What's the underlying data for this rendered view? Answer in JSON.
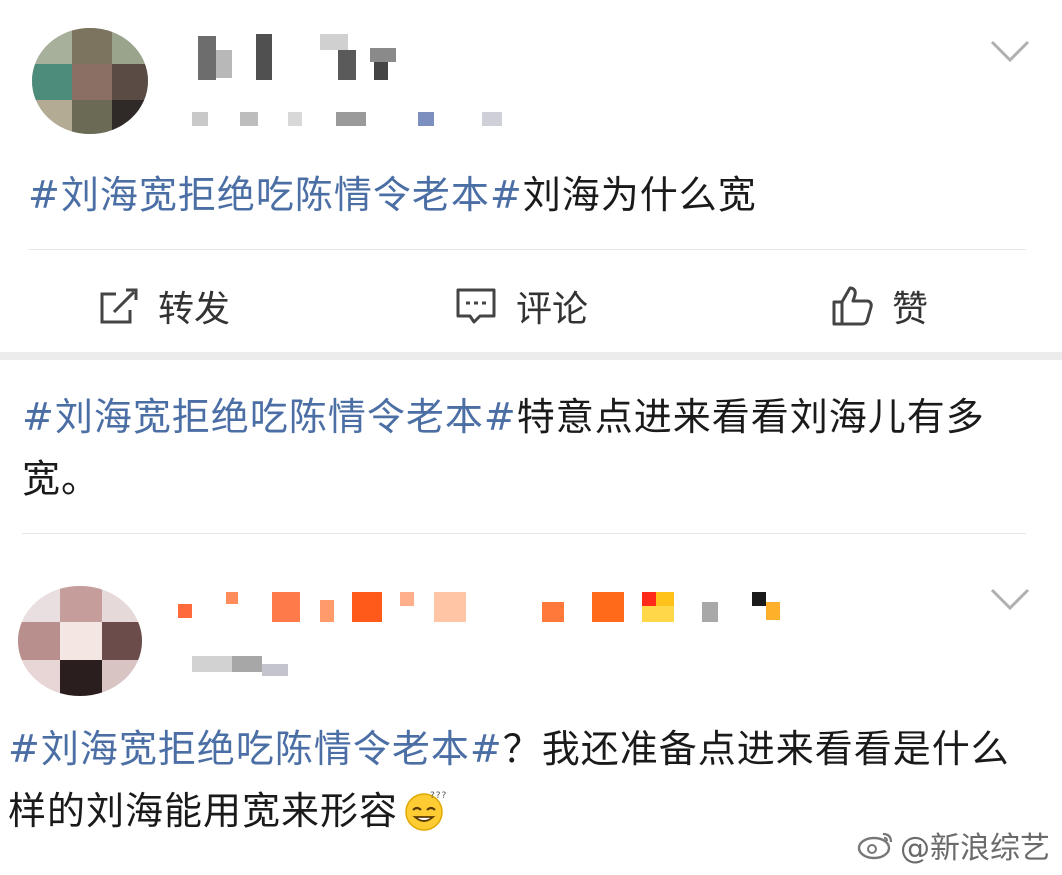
{
  "post1": {
    "topic": "#刘海宽拒绝吃陈情令老本#",
    "text": "刘海为什么宽",
    "actions": {
      "repost": "转发",
      "comment": "评论",
      "like": "赞"
    }
  },
  "comment1": {
    "topic": "#刘海宽拒绝吃陈情令老本#",
    "text": "特意点进来看看刘海儿有多宽。"
  },
  "post2": {
    "topic": "#刘海宽拒绝吃陈情令老本#",
    "text": "？我还准备点进来看看是什么样的刘海能用宽来形容"
  },
  "watermark": {
    "text": "@新浪综艺"
  },
  "colors": {
    "topic": "#4b6fa5",
    "text": "#1a1a1a",
    "divider": "#e8e8e8"
  },
  "icons": [
    "chevron-down-icon",
    "repost-icon",
    "comment-icon",
    "like-icon",
    "emoji-icon",
    "weibo-logo-icon"
  ]
}
